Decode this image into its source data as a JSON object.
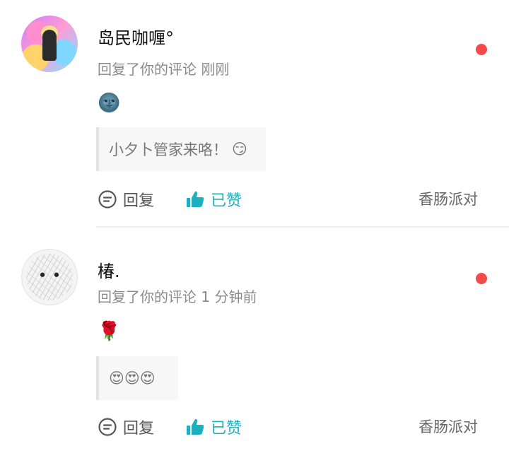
{
  "notifications": [
    {
      "username": "岛民咖喱°",
      "action_text": "回复了你的评论",
      "time": "刚刚",
      "reply_emoji": "🌚",
      "quoted_text": "小夕卜管家来咯！",
      "quoted_emoji": "😏",
      "reply_label": "回复",
      "liked_label": "已赞",
      "source": "香肠派对"
    },
    {
      "username": "椿.",
      "action_text": "回复了你的评论",
      "time": "1 分钟前",
      "reply_emoji": "🌹",
      "quoted_text": "",
      "quoted_emoji": "😍😍😍",
      "reply_label": "回复",
      "liked_label": "已赞",
      "source": "香肠派对"
    }
  ],
  "colors": {
    "accent": "#1ab0bf",
    "unread_dot": "#f44a4a"
  }
}
